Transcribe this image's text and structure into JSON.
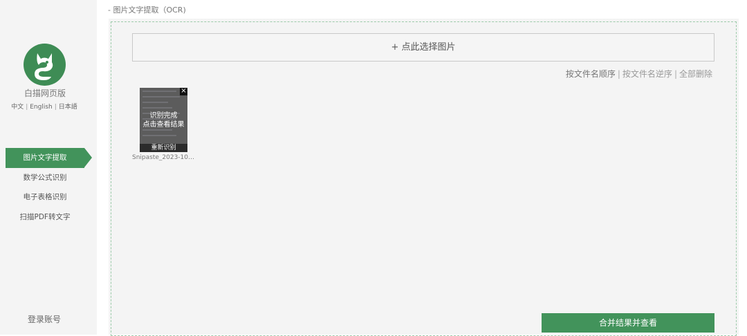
{
  "sidebar": {
    "brand": "白描网页版",
    "languages": [
      "中文",
      "English",
      "日本語"
    ],
    "lang_separator": "|",
    "menu": [
      {
        "label": "图片文字提取",
        "active": true
      },
      {
        "label": "数学公式识别",
        "active": false
      },
      {
        "label": "电子表格识别",
        "active": false
      },
      {
        "label": "扫描PDF转文字",
        "active": false
      }
    ],
    "login": "登录账号",
    "accent_color": "#42935b"
  },
  "main": {
    "breadcrumb": "- 图片文字提取（OCR)",
    "select_button": "+ 点此选择图片",
    "sort": {
      "by_name": "按文件名顺序",
      "by_name_reverse": "按文件名逆序",
      "delete_all": "全部删除",
      "separator": "|"
    },
    "files": [
      {
        "name": "Snipaste_2023-10-...",
        "status_line1": "识别完成",
        "status_line2": "点击查看结果",
        "rerun": "重新识别",
        "close": "×"
      }
    ],
    "merge_button": "合并结果并查看"
  }
}
